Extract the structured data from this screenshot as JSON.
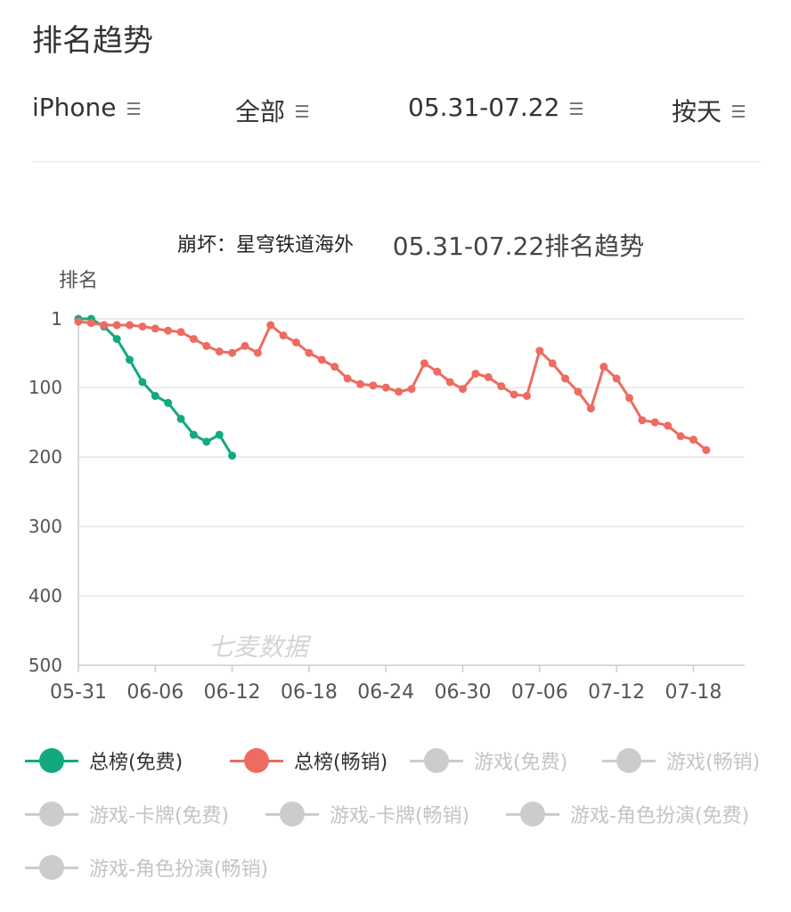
{
  "page": {
    "title": "排名趋势"
  },
  "filters": [
    {
      "label": "iPhone",
      "icon": "menu-icon"
    },
    {
      "label": "全部",
      "icon": "menu-icon"
    },
    {
      "label": "05.31-07.22",
      "icon": "menu-icon"
    },
    {
      "label": "按天",
      "icon": "menu-icon"
    }
  ],
  "colors": {
    "free": "#12a981",
    "paid": "#ee6b61",
    "inactive": "#cccccc",
    "grid": "#e6e6e6",
    "axis": "#cccccc"
  },
  "chart_data": {
    "type": "line",
    "title_app": "崩坏：星穹铁道海外",
    "title": "05.31-07.22排名趋势",
    "ylabel": "排名",
    "watermark": "七麦数据",
    "y_ticks": [
      "1",
      "100",
      "200",
      "300",
      "400",
      "500"
    ],
    "y_tick_values": [
      1,
      100,
      200,
      300,
      400,
      500
    ],
    "y_range": [
      1,
      500
    ],
    "y_inverted": true,
    "x_tick_labels": [
      "05-31",
      "06-06",
      "06-12",
      "06-18",
      "06-24",
      "06-30",
      "07-06",
      "07-12",
      "07-18"
    ],
    "x_tick_dates": [
      "05-31",
      "06-06",
      "06-12",
      "06-18",
      "06-24",
      "06-30",
      "07-06",
      "07-12",
      "07-18"
    ],
    "x_range": [
      "05-31",
      "07-22"
    ],
    "grid": true,
    "series": [
      {
        "name": "总榜(免费)",
        "color": "#12a981",
        "active": true,
        "points": [
          {
            "x": "05-31",
            "y": 1
          },
          {
            "x": "06-01",
            "y": 1
          },
          {
            "x": "06-02",
            "y": 12
          },
          {
            "x": "06-03",
            "y": 30
          },
          {
            "x": "06-04",
            "y": 60
          },
          {
            "x": "06-05",
            "y": 92
          },
          {
            "x": "06-06",
            "y": 112
          },
          {
            "x": "06-07",
            "y": 122
          },
          {
            "x": "06-08",
            "y": 145
          },
          {
            "x": "06-09",
            "y": 168
          },
          {
            "x": "06-10",
            "y": 178
          },
          {
            "x": "06-11",
            "y": 168
          },
          {
            "x": "06-12",
            "y": 198
          }
        ]
      },
      {
        "name": "总榜(畅销)",
        "color": "#ee6b61",
        "active": true,
        "points": [
          {
            "x": "05-31",
            "y": 5
          },
          {
            "x": "06-01",
            "y": 7
          },
          {
            "x": "06-02",
            "y": 10
          },
          {
            "x": "06-03",
            "y": 10
          },
          {
            "x": "06-04",
            "y": 10
          },
          {
            "x": "06-05",
            "y": 12
          },
          {
            "x": "06-06",
            "y": 15
          },
          {
            "x": "06-07",
            "y": 18
          },
          {
            "x": "06-08",
            "y": 20
          },
          {
            "x": "06-09",
            "y": 30
          },
          {
            "x": "06-10",
            "y": 40
          },
          {
            "x": "06-11",
            "y": 48
          },
          {
            "x": "06-12",
            "y": 50
          },
          {
            "x": "06-13",
            "y": 40
          },
          {
            "x": "06-14",
            "y": 50
          },
          {
            "x": "06-15",
            "y": 10
          },
          {
            "x": "06-16",
            "y": 25
          },
          {
            "x": "06-17",
            "y": 35
          },
          {
            "x": "06-18",
            "y": 50
          },
          {
            "x": "06-19",
            "y": 60
          },
          {
            "x": "06-20",
            "y": 70
          },
          {
            "x": "06-21",
            "y": 87
          },
          {
            "x": "06-22",
            "y": 95
          },
          {
            "x": "06-23",
            "y": 97
          },
          {
            "x": "06-24",
            "y": 100
          },
          {
            "x": "06-25",
            "y": 106
          },
          {
            "x": "06-26",
            "y": 102
          },
          {
            "x": "06-27",
            "y": 65
          },
          {
            "x": "06-28",
            "y": 77
          },
          {
            "x": "06-29",
            "y": 92
          },
          {
            "x": "06-30",
            "y": 102
          },
          {
            "x": "07-01",
            "y": 80
          },
          {
            "x": "07-02",
            "y": 85
          },
          {
            "x": "07-03",
            "y": 98
          },
          {
            "x": "07-04",
            "y": 110
          },
          {
            "x": "07-05",
            "y": 112
          },
          {
            "x": "07-06",
            "y": 47
          },
          {
            "x": "07-07",
            "y": 65
          },
          {
            "x": "07-08",
            "y": 87
          },
          {
            "x": "07-09",
            "y": 106
          },
          {
            "x": "07-10",
            "y": 130
          },
          {
            "x": "07-11",
            "y": 70
          },
          {
            "x": "07-12",
            "y": 87
          },
          {
            "x": "07-13",
            "y": 115
          },
          {
            "x": "07-14",
            "y": 147
          },
          {
            "x": "07-15",
            "y": 150
          },
          {
            "x": "07-16",
            "y": 155
          },
          {
            "x": "07-17",
            "y": 170
          },
          {
            "x": "07-18",
            "y": 175
          },
          {
            "x": "07-19",
            "y": 190
          }
        ]
      }
    ],
    "legend": [
      {
        "name": "总榜(免费)",
        "active": true,
        "color": "#12a981"
      },
      {
        "name": "总榜(畅销)",
        "active": true,
        "color": "#ee6b61"
      },
      {
        "name": "游戏(免费)",
        "active": false
      },
      {
        "name": "游戏(畅销)",
        "active": false
      },
      {
        "name": "游戏-卡牌(免费)",
        "active": false
      },
      {
        "name": "游戏-卡牌(畅销)",
        "active": false
      },
      {
        "name": "游戏-角色扮演(免费)",
        "active": false
      },
      {
        "name": "游戏-角色扮演(畅销)",
        "active": false
      }
    ],
    "legend_placement": "bottom"
  }
}
